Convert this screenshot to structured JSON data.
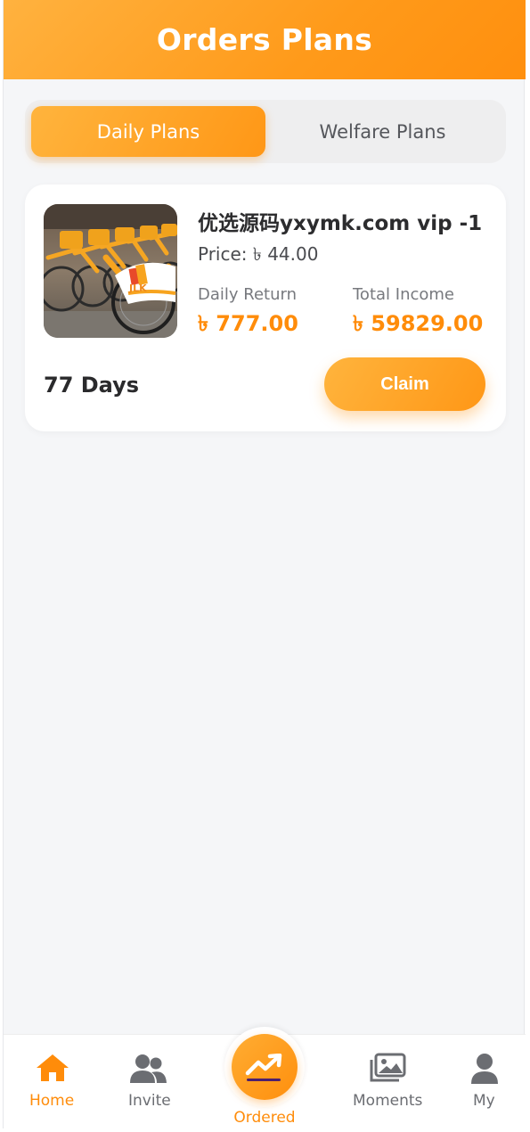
{
  "header": {
    "title": "Orders Plans"
  },
  "tabs": [
    {
      "label": "Daily Plans",
      "active": true
    },
    {
      "label": "Welfare Plans",
      "active": false
    }
  ],
  "plan": {
    "title": "优选源码yxymk.com vip -1",
    "price": "Price: ৳ 44.00",
    "daily_return_label": "Daily Return",
    "daily_return_value": "৳ 777.00",
    "total_income_label": "Total Income",
    "total_income_value": "৳ 59829.00",
    "days": "77 Days",
    "claim_label": "Claim",
    "image_logo": "JLK"
  },
  "bottom_nav": {
    "home": "Home",
    "invite": "Invite",
    "ordered": "Ordered",
    "moments": "Moments",
    "my": "My"
  },
  "icons": {
    "home": "home-icon",
    "invite": "users-icon",
    "ordered": "trending-up-icon",
    "moments": "photos-icon",
    "my": "user-icon"
  },
  "colors": {
    "accent": "#ff9a1a",
    "accent_light": "#ffb43d",
    "value_text": "#ff8c0a",
    "background": "#f5f6f8",
    "inactive_icon": "#6b6d72"
  }
}
